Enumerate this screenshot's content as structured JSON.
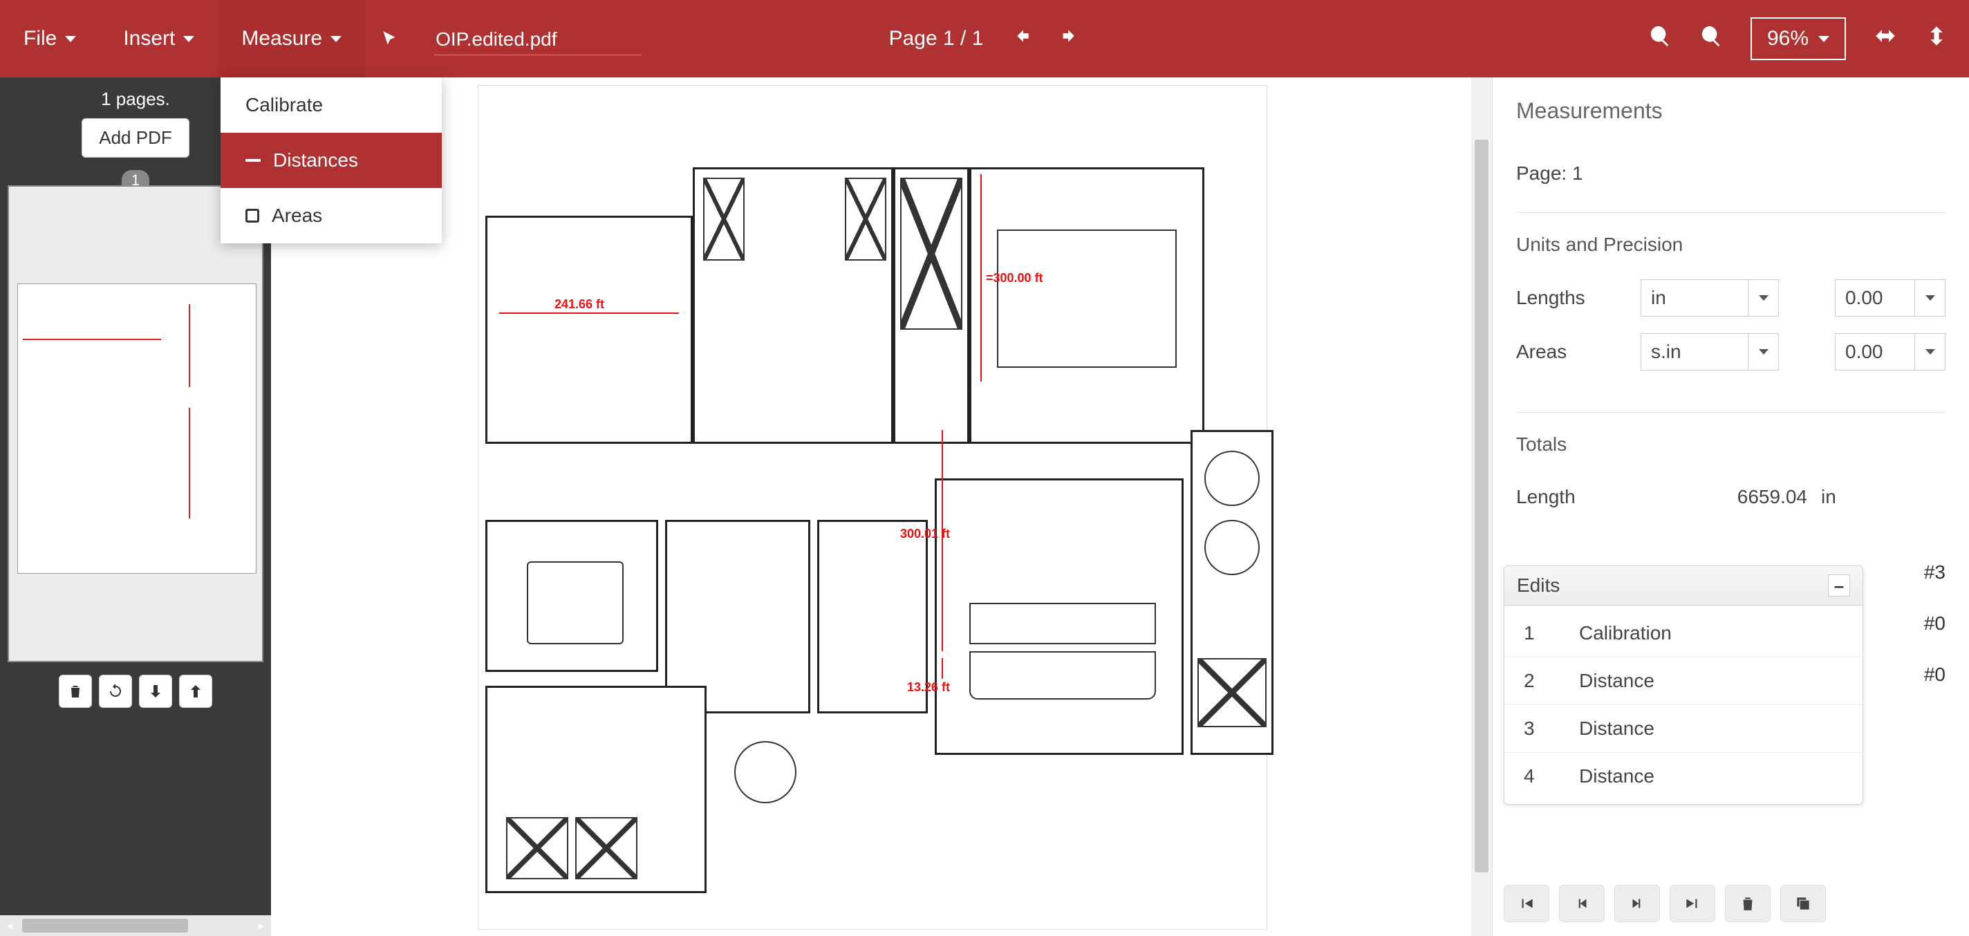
{
  "menubar": {
    "file": "File",
    "insert": "Insert",
    "measure": "Measure",
    "filename": "OIP.edited.pdf",
    "page_indicator": "Page 1 / 1",
    "zoom": "96%"
  },
  "measure_menu": {
    "calibrate": "Calibrate",
    "distances": "Distances",
    "areas": "Areas"
  },
  "thumbnails": {
    "pages_label": "1 pages.",
    "add_pdf": "Add PDF",
    "badge": "1"
  },
  "dimensions": {
    "d1": "241.66 ft",
    "d2": "=300.00 ft",
    "d3": "300.01 ft",
    "d4": "13.26 ft"
  },
  "panel": {
    "title": "Measurements",
    "page": "Page: 1",
    "units_header": "Units and Precision",
    "lengths_label": "Lengths",
    "lengths_unit": "in",
    "lengths_precision": "0.00",
    "areas_label": "Areas",
    "areas_unit": "s.in",
    "areas_precision": "0.00",
    "totals_header": "Totals",
    "total_length_label": "Length",
    "total_length_value": "6659.04",
    "total_length_unit": "in",
    "hash": [
      "#3",
      "#0",
      "#0"
    ]
  },
  "edits": {
    "title": "Edits",
    "minimize": "–",
    "rows": [
      {
        "n": "1",
        "label": "Calibration"
      },
      {
        "n": "2",
        "label": "Distance"
      },
      {
        "n": "3",
        "label": "Distance"
      },
      {
        "n": "4",
        "label": "Distance"
      }
    ]
  }
}
